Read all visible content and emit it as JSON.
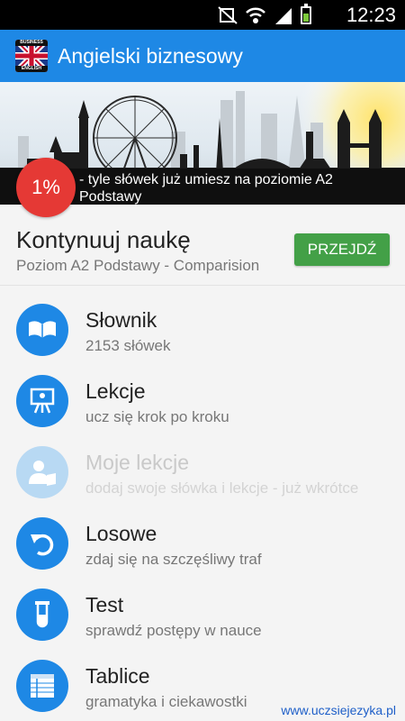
{
  "status_bar": {
    "time": "12:23",
    "icons": [
      "mute-icon",
      "wifi-icon",
      "signal-icon",
      "battery-icon"
    ]
  },
  "action_bar": {
    "title": "Angielski biznesowy",
    "flag_top_text": "BUSINESS",
    "flag_bottom_text": "ENGLISH"
  },
  "banner": {
    "progress": "1%",
    "text": "- tyle słówek już umiesz na poziomie A2 Podstawy"
  },
  "continue": {
    "heading": "Kontynuuj naukę",
    "subtitle": "Poziom A2 Podstawy - Comparision",
    "button": "PRZEJDŹ"
  },
  "menu": [
    {
      "label": "Słownik",
      "desc": "2153 słówek",
      "icon": "book-icon",
      "enabled": true
    },
    {
      "label": "Lekcje",
      "desc": "ucz się krok po kroku",
      "icon": "easel-icon",
      "enabled": true
    },
    {
      "label": "Moje lekcje",
      "desc": "dodaj swoje słówka i lekcje - już wkrótce",
      "icon": "user-book-icon",
      "enabled": false
    },
    {
      "label": "Losowe",
      "desc": "zdaj się na szczęśliwy traf",
      "icon": "undo-arrow-icon",
      "enabled": true
    },
    {
      "label": "Test",
      "desc": "sprawdź postępy w nauce",
      "icon": "test-tube-icon",
      "enabled": true
    },
    {
      "label": "Tablice",
      "desc": "gramatyka i ciekawostki",
      "icon": "table-icon",
      "enabled": true
    }
  ],
  "footer": {
    "link": "www.uczsiejezyka.pl"
  },
  "colors": {
    "primary": "#1e88e5",
    "progress": "#e53935",
    "button": "#43a047",
    "disabled": "#b8d9f3"
  }
}
